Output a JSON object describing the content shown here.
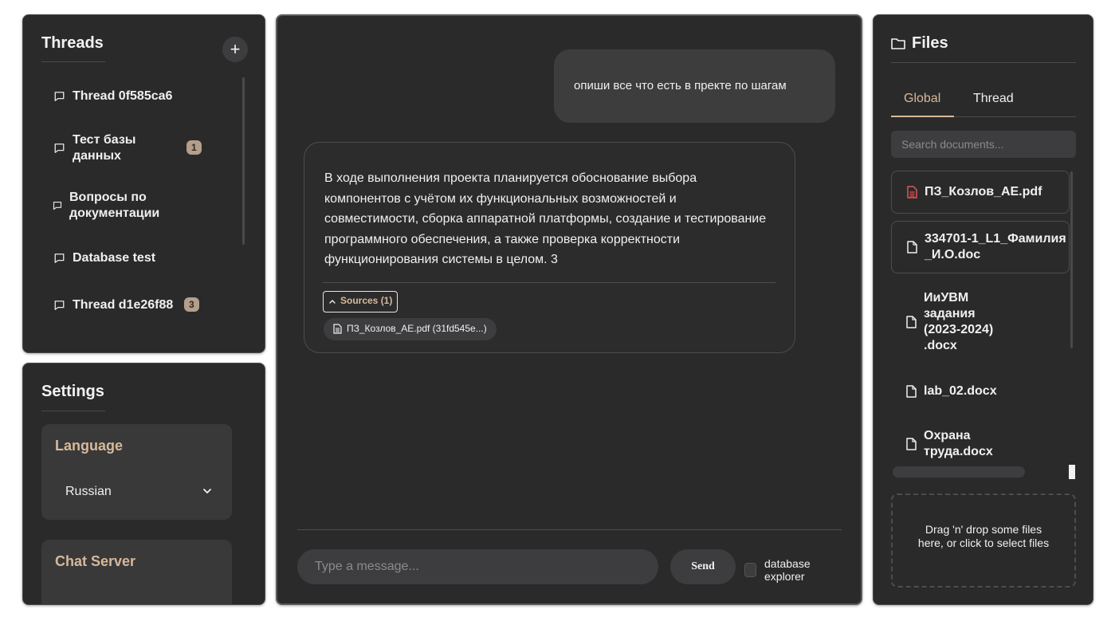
{
  "threads": {
    "title": "Threads",
    "add_label": "+",
    "items": [
      {
        "label": "Thread 0f585ca6",
        "badge": null
      },
      {
        "label": "Тест базы данных",
        "badge": "1"
      },
      {
        "label": "Вопросы по документации",
        "badge": null
      },
      {
        "label": "Database test",
        "badge": null
      },
      {
        "label": "Thread d1e26f88",
        "badge": "3"
      }
    ]
  },
  "settings": {
    "title": "Settings",
    "language_label": "Language",
    "language_value": "Russian",
    "chat_server_label": "Chat Server"
  },
  "chat": {
    "user_message": "опиши все что есть в пректе по шагам",
    "assistant_message": "В ходе выполнения проекта планируется обоснование выбора компонентов с учётом их функциональных возможностей и совместимости, сборка аппаратной платформы, создание и тестирование программного обеспечения, а также проверка корректности функционирования системы в целом. 3",
    "sources_label": "Sources (1)",
    "source_chip": "ПЗ_Козлов_АЕ.pdf (31fd545e...)",
    "input_placeholder": "Type a message...",
    "send_label": "Send",
    "db_explorer_label": "database explorer"
  },
  "files": {
    "title": "Files",
    "tabs": [
      "Global",
      "Thread"
    ],
    "active_tab": "Global",
    "search_placeholder": "Search documents...",
    "items": [
      {
        "name": "ПЗ_Козлов_АЕ.pdf",
        "icon": "pdf-file-icon"
      },
      {
        "name": "334701-1_L1_Фамилия_И.О.doc",
        "icon": "file-icon"
      },
      {
        "name": "ИиУВМ задания (2023-2024) .docx",
        "icon": "file-icon"
      },
      {
        "name": "lab_02.docx",
        "icon": "file-icon"
      },
      {
        "name": "Охрана труда.docx",
        "icon": "file-icon"
      }
    ],
    "dropzone_text": "Drag 'n' drop some files here, or click to select files"
  },
  "colors": {
    "panel_bg": "#2a2a2b",
    "accent": "#d6b99a",
    "badge_bg": "#b59f8a",
    "pdf_icon": "#e05555"
  }
}
